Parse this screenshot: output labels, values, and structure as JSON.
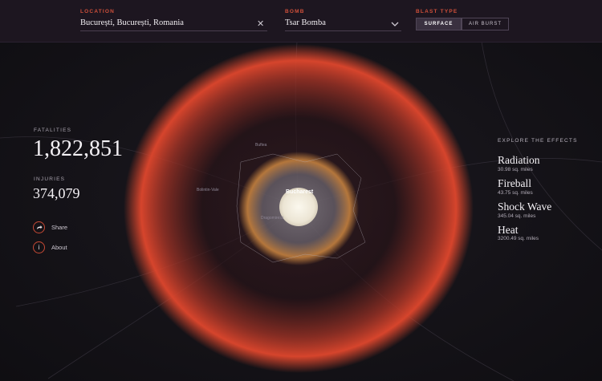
{
  "header": {
    "location": {
      "label": "LOCATION",
      "value": "București, București, Romania"
    },
    "bomb": {
      "label": "BOMB",
      "value": "Tsar Bomba"
    },
    "blast_type": {
      "label": "BLAST TYPE",
      "options": [
        {
          "label": "SURFACE",
          "selected": true
        },
        {
          "label": "AIR BURST",
          "selected": false
        }
      ]
    }
  },
  "stats": {
    "fatalities_label": "FATALITIES",
    "fatalities_value": "1,822,851",
    "injuries_label": "INJURIES",
    "injuries_value": "374,079"
  },
  "actions": {
    "share_label": "Share",
    "about_label": "About"
  },
  "effects": {
    "title": "EXPLORE THE EFFECTS",
    "items": [
      {
        "name": "Radiation",
        "area": "30.98 sq. miles"
      },
      {
        "name": "Fireball",
        "area": "43.75 sq. miles"
      },
      {
        "name": "Shock Wave",
        "area": "345.04 sq. miles"
      },
      {
        "name": "Heat",
        "area": "3200.49 sq. miles"
      }
    ]
  },
  "map": {
    "city_label": "Bucharest",
    "colors": {
      "heat_ring": "#d9432b",
      "shockwave_ring": "#c97a3e",
      "fireball": "#f4efe2",
      "accent": "#d0503a"
    }
  },
  "icons": {
    "close": "close-icon",
    "chevron": "chevron-down-icon",
    "share": "share-icon",
    "about": "info-icon"
  }
}
